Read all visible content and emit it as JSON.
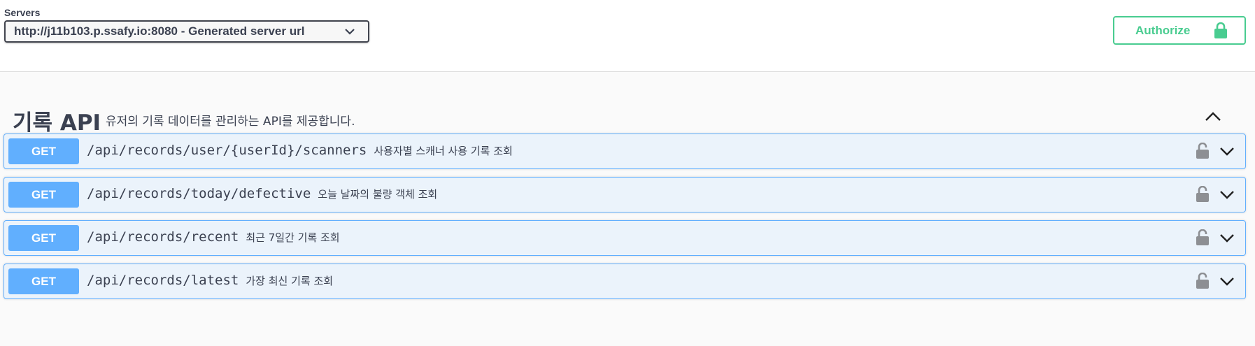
{
  "servers": {
    "label": "Servers",
    "selected": "http://j11b103.p.ssafy.io:8080 - Generated server url"
  },
  "authorize": {
    "label": "Authorize",
    "icon": "lock-icon"
  },
  "tag": {
    "name": "기록 API",
    "description": "유저의 기록 데이터를 관리하는 API를 제공합니다."
  },
  "colors": {
    "get_accent": "#61affe",
    "get_background": "#ebf3fb",
    "authorize": "#49cc90",
    "text": "#3b4151"
  },
  "operations": [
    {
      "method": "GET",
      "path": "/api/records/user/{userId}/scanners",
      "summary": "사용자별 스캐너 사용 기록 조회"
    },
    {
      "method": "GET",
      "path": "/api/records/today/defective",
      "summary": "오늘 날짜의 불량 객체 조회"
    },
    {
      "method": "GET",
      "path": "/api/records/recent",
      "summary": "최근 7일간 기록 조회"
    },
    {
      "method": "GET",
      "path": "/api/records/latest",
      "summary": "가장 최신 기록 조회"
    }
  ]
}
